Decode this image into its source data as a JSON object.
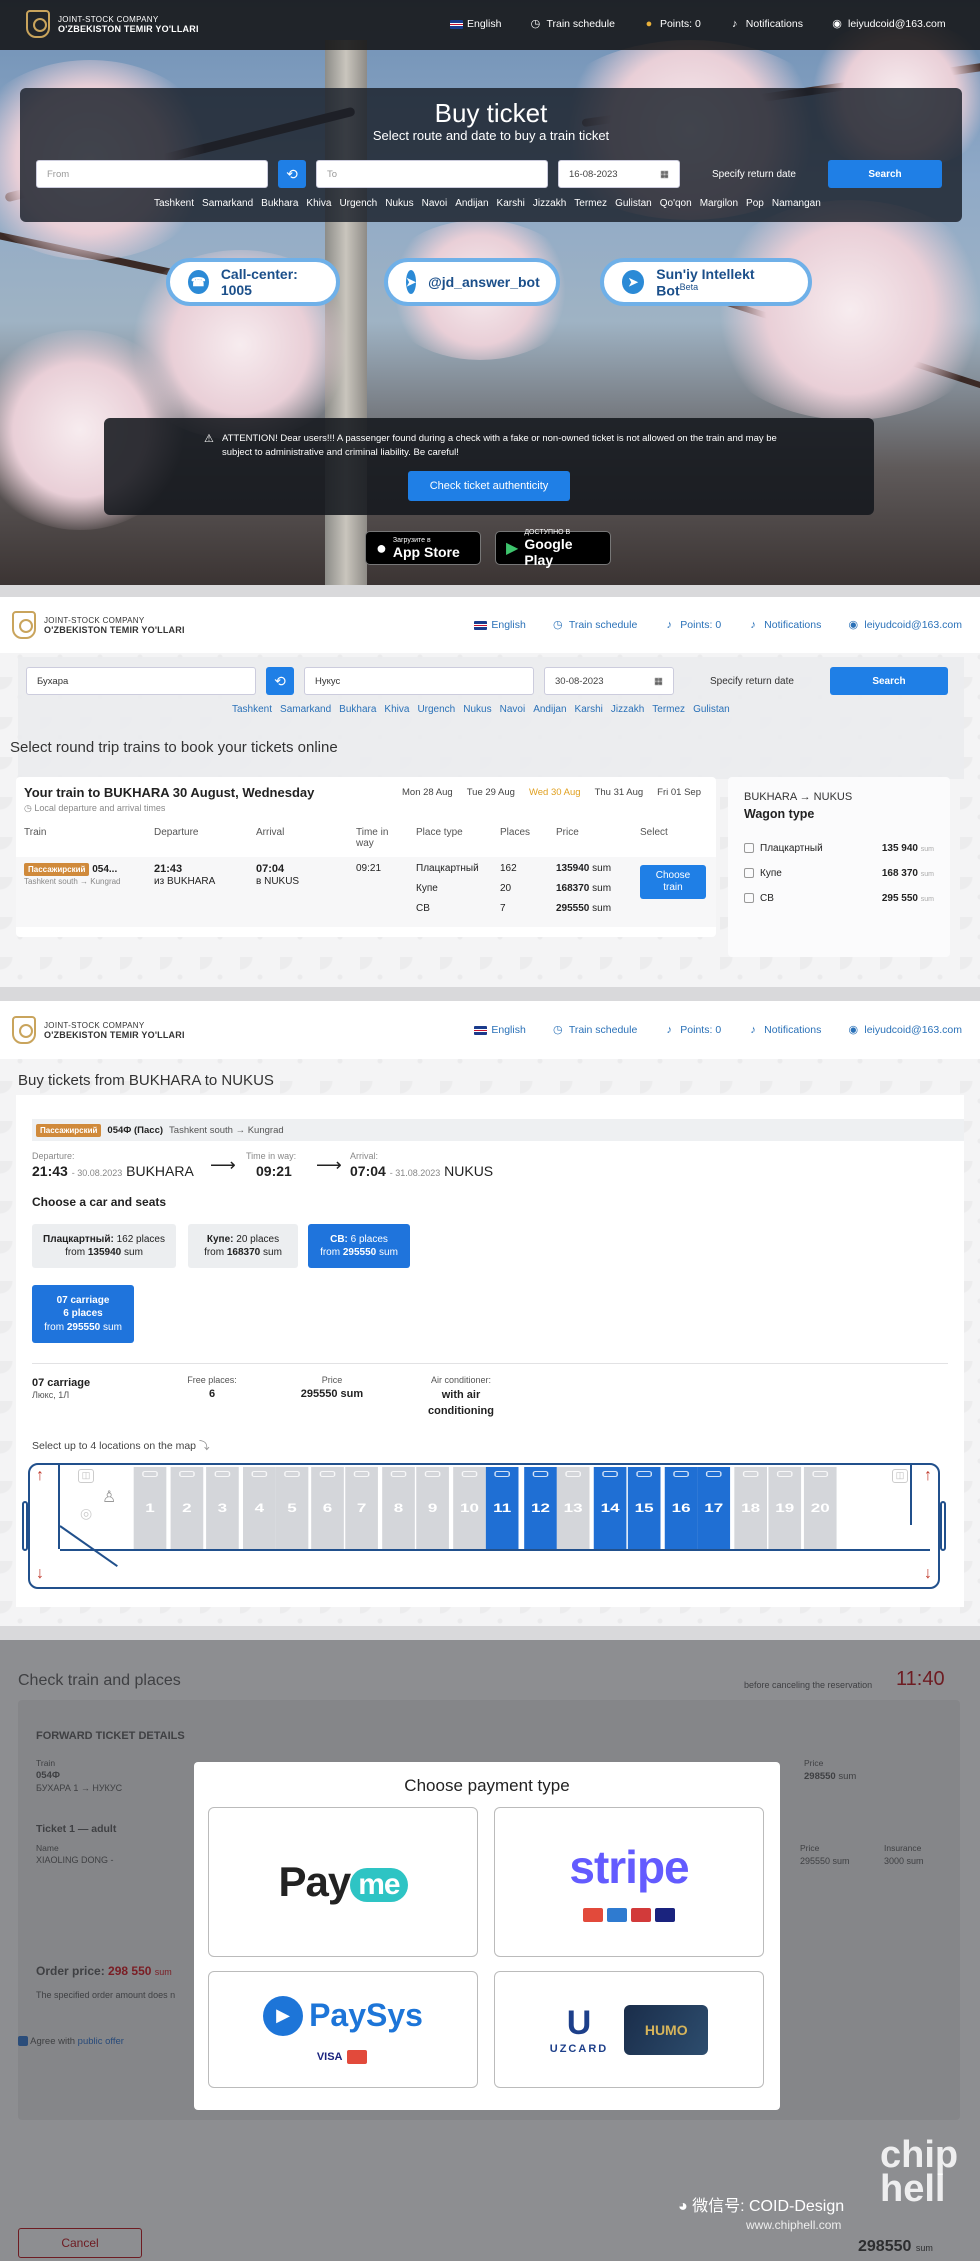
{
  "header": {
    "company_line1": "JOINT-STOCK COMPANY",
    "company_line2": "O'ZBEKISTON TEMIR YO'LLARI",
    "nav": {
      "language": "English",
      "schedule": "Train schedule",
      "points": "Points: 0",
      "notifications": "Notifications",
      "account": "leiyudcoid@163.com"
    }
  },
  "home": {
    "title": "Buy ticket",
    "subtitle": "Select route and date to buy a train ticket",
    "from_placeholder": "From",
    "to_placeholder": "To",
    "date": "16-08-2023",
    "return_label": "Specify return date",
    "search_label": "Search",
    "cities": [
      "Tashkent",
      "Samarkand",
      "Bukhara",
      "Khiva",
      "Urgench",
      "Nukus",
      "Navoi",
      "Andijan",
      "Karshi",
      "Jizzakh",
      "Termez",
      "Gulistan",
      "Qo'qon",
      "Margilon",
      "Pop",
      "Namangan"
    ],
    "call_center": "Call-center: 1005",
    "bot": "@jd_answer_bot",
    "ai_bot": "Sun'iy Intellekt Bot",
    "ai_bot_sup": "Beta",
    "warning": "ATTENTION! Dear users!!! A passenger found during a check with a fake or non-owned ticket is not allowed on the train and may be subject to administrative and criminal liability. Be careful!",
    "check_btn": "Check ticket authenticity",
    "appstore_small": "Загрузите в",
    "appstore": "App Store",
    "gplay_small": "ДОСТУПНО В",
    "gplay": "Google Play"
  },
  "round": {
    "from": "Бухара",
    "to": "Нукус",
    "date": "30-08-2023",
    "return_label": "Specify return date",
    "search_label": "Search",
    "cities": [
      "Tashkent",
      "Samarkand",
      "Bukhara",
      "Khiva",
      "Urgench",
      "Nukus",
      "Navoi",
      "Andijan",
      "Karshi",
      "Jizzakh",
      "Termez",
      "Gulistan"
    ],
    "heading": "Select round trip trains to book your tickets online",
    "train_title": "Your train to BUKHARA 30 August, Wednesday",
    "train_note": "Local departure and arrival times",
    "days": [
      "Mon 28 Aug",
      "Tue 29 Aug",
      "Wed 30 Aug",
      "Thu 31 Aug",
      "Fri 01 Sep"
    ],
    "cols": [
      "Train",
      "Departure",
      "Arrival",
      "Time in way",
      "Place type",
      "Places",
      "Price",
      "Select"
    ],
    "badge": "Пассажирский",
    "train_no": "054...",
    "train_route": "Tashkent south → Kungrad",
    "dep_time": "21:43",
    "dep_from": "из BUKHARA",
    "arr_time": "07:04",
    "arr_to": "в NUKUS",
    "duration": "09:21",
    "classes": [
      {
        "type": "Плацкартный",
        "places": "162",
        "price": "135940",
        "unit": "sum"
      },
      {
        "type": "Купе",
        "places": "20",
        "price": "168370",
        "unit": "sum"
      },
      {
        "type": "СВ",
        "places": "7",
        "price": "295550",
        "unit": "sum"
      }
    ],
    "choose_btn": "Choose train",
    "side_route": "BUKHARA → NUKUS",
    "side_title": "Wagon type",
    "side_items": [
      {
        "type": "Плацкартный",
        "price": "135 940",
        "unit": "sum"
      },
      {
        "type": "Купе",
        "price": "168 370",
        "unit": "sum"
      },
      {
        "type": "СВ",
        "price": "295 550",
        "unit": "sum"
      }
    ]
  },
  "seats": {
    "heading": "Buy tickets from BUKHARA to NUKUS",
    "badge": "Пассажирский",
    "train": "054Ф (Пасс)",
    "route": "Tashkent south → Kungrad",
    "departure_label": "Departure:",
    "dep_time": "21:43",
    "dep_date": "- 30.08.2023",
    "dep_city": "BUKHARA",
    "way_label": "Time in way:",
    "way": "09:21",
    "arrival_label": "Arrival:",
    "arr_time": "07:04",
    "arr_date": "- 31.08.2023",
    "arr_city": "NUKUS",
    "choose_label": "Choose a car and seats",
    "car_types": [
      {
        "name": "Плацкартный:",
        "places": "162 places",
        "from": "from",
        "price": "135940",
        "unit": "sum"
      },
      {
        "name": "Купе:",
        "places": "20 places",
        "from": "from",
        "price": "168370",
        "unit": "sum"
      },
      {
        "name": "СВ:",
        "places": "6 places",
        "from": "from",
        "price": "295550",
        "unit": "sum"
      }
    ],
    "carriage_btn": {
      "l1": "07 carriage",
      "l2": "6 places",
      "l3": "from",
      "price": "295550",
      "unit": "sum"
    },
    "carriage_name": "07 carriage",
    "carriage_class": "Люкс, 1Л",
    "free_label": "Free places:",
    "free": "6",
    "price_label": "Price",
    "price": "295550 sum",
    "ac_label": "Air conditioner:",
    "ac": "with air conditioning",
    "map_hint": "Select up to 4 locations on the map",
    "seat_numbers": [
      "1",
      "2",
      "3",
      "4",
      "5",
      "6",
      "7",
      "8",
      "9",
      "10",
      "11",
      "12",
      "13",
      "14",
      "15",
      "16",
      "17",
      "18",
      "19",
      "20"
    ],
    "seat_available": [
      false,
      false,
      false,
      false,
      false,
      false,
      false,
      false,
      false,
      false,
      true,
      true,
      false,
      true,
      true,
      true,
      true,
      false,
      false,
      false
    ]
  },
  "checkout": {
    "heading": "Check train and places",
    "timer_label": "before canceling the reservation",
    "timer": "11:40",
    "forward": "FORWARD TICKET DETAILS",
    "train_label": "Train",
    "train": "054Ф",
    "route": "БУХАРА 1 → НУКУС",
    "price_label": "Price",
    "price": "298550",
    "unit": "sum",
    "ticket": "Ticket 1 — adult",
    "name_label": "Name",
    "name": "XIAOLING DONG -",
    "ticket_price": "295550 sum",
    "insurance_label": "Insurance",
    "insurance": "3000 sum",
    "order_label": "Order price:",
    "order_price": "298 550",
    "order_unit": "sum",
    "order_note": "The specified order amount does n",
    "agree": "Agree with",
    "offer": "public offer",
    "cancel": "Cancel",
    "total": "298550",
    "total_unit": "sum",
    "modal_title": "Choose payment type",
    "payme_a": "Pay",
    "payme_b": "me",
    "stripe": "stripe",
    "paysys": "PaySys",
    "uzcard": "UZCARD",
    "humo": "HUMO",
    "visa": "VISA"
  },
  "watermark": {
    "wechat": "微信号: COID-Design",
    "site": "www.chiphell.com",
    "logo": "chip hell"
  }
}
